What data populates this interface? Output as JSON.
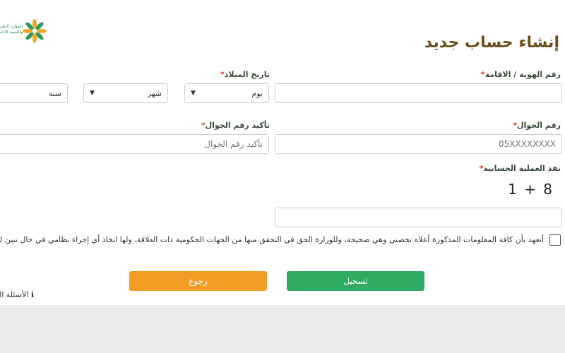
{
  "logo": {
    "name_line1": "الموارد البشرية",
    "name_line2": "والتنمية الاجتماعية"
  },
  "title": "إنشاء حساب جديد",
  "form": {
    "id_label": "رقم الهوية / الاقامة",
    "birth_label": "تاريخ الميلاد",
    "birth_day": "يوم",
    "birth_month": "شهر",
    "birth_year": "سنة",
    "mobile_label": "رقم الجوال",
    "mobile_placeholder": "05XXXXXXXX",
    "confirm_label": "تأكيد رقم الجوال",
    "confirm_placeholder": "تأكيد رقم الجوال",
    "captcha_label": "نفذ العملية الحسابية",
    "captcha_expression": "1 + 8",
    "required_mark": "*",
    "agree_text": "أتعهد بأن كافة المعلومات المذكورة أعلاه تخصني وهي صحيحة، وللوزارة الحق في التحقق منها من الجهات الحكومية ذات العلاقة، ولها اتخاذ أي إجراء نظامي في حال تبين لها عدم صحتها"
  },
  "buttons": {
    "register": "تسجيل",
    "back": "رجوع"
  },
  "faq": "الأسئلة الشائعة",
  "colors": {
    "title": "#6b4e1e",
    "required": "#e03a2f",
    "register": "#2eaa62",
    "back": "#f39c23"
  }
}
